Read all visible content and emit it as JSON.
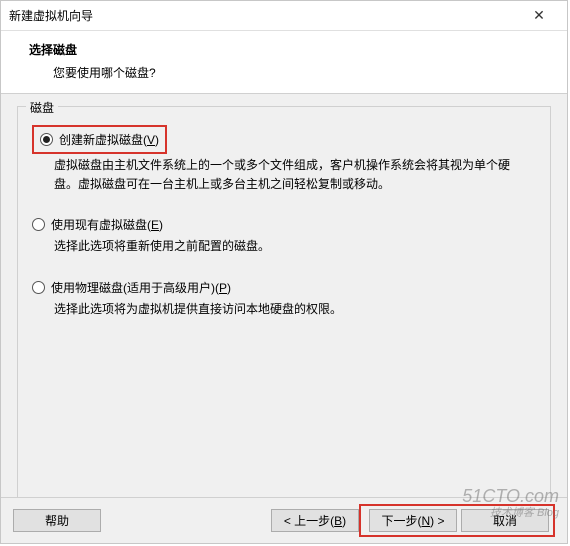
{
  "window": {
    "title": "新建虚拟机向导",
    "close": "✕"
  },
  "header": {
    "title": "选择磁盘",
    "subtitle": "您要使用哪个磁盘?"
  },
  "group": {
    "legend": "磁盘"
  },
  "options": {
    "create": {
      "label_pre": "创建新虚拟磁盘(",
      "accel": "V",
      "label_post": ")",
      "desc": "虚拟磁盘由主机文件系统上的一个或多个文件组成，客户机操作系统会将其视为单个硬盘。虚拟磁盘可在一台主机上或多台主机之间轻松复制或移动。"
    },
    "existing": {
      "label_pre": "使用现有虚拟磁盘(",
      "accel": "E",
      "label_post": ")",
      "desc": "选择此选项将重新使用之前配置的磁盘。"
    },
    "physical": {
      "label_pre": "使用物理磁盘(适用于高级用户)(",
      "accel": "P",
      "label_post": ")",
      "desc": "选择此选项将为虚拟机提供直接访问本地硬盘的权限。"
    }
  },
  "buttons": {
    "help": "帮助",
    "back_pre": "< 上一步(",
    "back_accel": "B",
    "back_post": ")",
    "next_pre": "下一步(",
    "next_accel": "N",
    "next_post": ") >",
    "cancel": "取消"
  },
  "watermark": {
    "main": "51CTO.com",
    "sub": "技术博客 Blog"
  }
}
